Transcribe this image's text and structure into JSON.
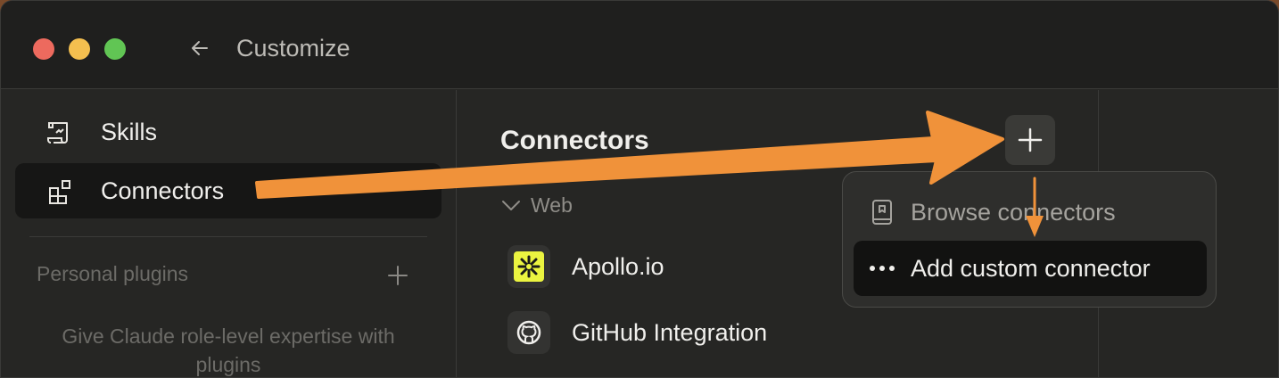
{
  "window": {
    "title": "Customize"
  },
  "sidebar": {
    "items": [
      {
        "label": "Skills",
        "icon": "scroll-icon",
        "active": false
      },
      {
        "label": "Connectors",
        "icon": "grid-icon",
        "active": true
      }
    ],
    "personal_plugins_label": "Personal plugins",
    "plugins_hint": "Give Claude role-level expertise with plugins"
  },
  "main": {
    "title": "Connectors",
    "group": "Web",
    "connectors": [
      {
        "name": "Apollo.io",
        "icon": "apollo-icon"
      },
      {
        "name": "GitHub Integration",
        "icon": "github-icon"
      }
    ]
  },
  "menu": {
    "items": [
      {
        "label": "Browse connectors",
        "icon": "book-icon",
        "highlighted": false
      },
      {
        "label": "Add custom connector",
        "icon": "more-icon",
        "highlighted": true
      }
    ]
  },
  "colors": {
    "accent_arrow": "#f0923a",
    "apollo_bg": "#ebf440"
  }
}
